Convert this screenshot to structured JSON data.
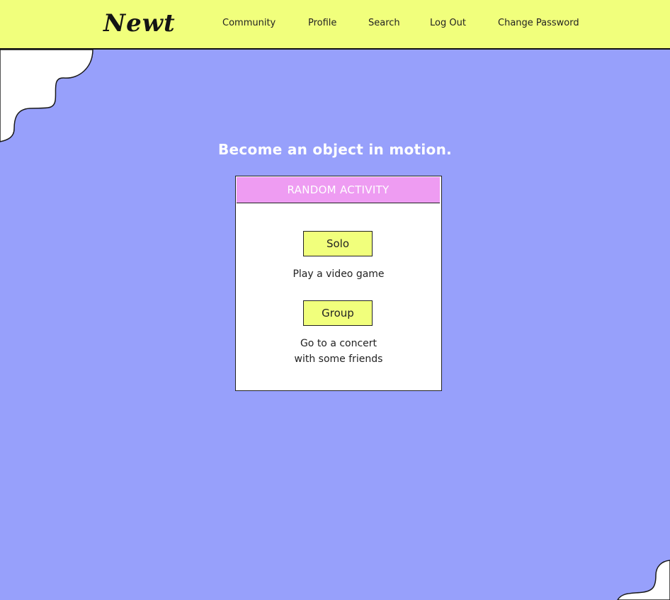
{
  "header": {
    "logo": "Newt",
    "nav": [
      "Community",
      "Profile",
      "Search",
      "Log Out",
      "Change Password"
    ]
  },
  "main": {
    "tagline": "Become an object in motion."
  },
  "card": {
    "title": "RANDOM ACTIVITY",
    "solo": {
      "button": "Solo",
      "activity": "Play a video game"
    },
    "group": {
      "button": "Group",
      "activity_line1": "Go to a concert",
      "activity_line2": "with some friends"
    }
  },
  "colors": {
    "background": "#97a0fb",
    "navbar": "#f1ff7c",
    "card_header": "#ee9cf2",
    "button": "#f1ff7c"
  }
}
